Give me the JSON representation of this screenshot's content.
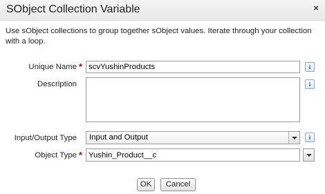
{
  "dialog": {
    "title": "SObject Collection Variable",
    "close_glyph": "×",
    "description": "Use sObject collections to group together sObject values. Iterate through your collection with a loop."
  },
  "form": {
    "unique_name": {
      "label": "Unique Name",
      "value": "scvYushinProducts",
      "required": true
    },
    "description": {
      "label": "Description",
      "value": ""
    },
    "io_type": {
      "label": "Input/Output Type",
      "value": "Input and Output"
    },
    "object_type": {
      "label": "Object Type",
      "value": "Yushin_Product__c",
      "required": true
    },
    "info_glyph": "i",
    "required_glyph": "*"
  },
  "buttons": {
    "ok": "OK",
    "cancel": "Cancel"
  },
  "icons": {
    "close": "close-icon",
    "info": "info-icon",
    "dropdown": "chevron-down-icon"
  }
}
